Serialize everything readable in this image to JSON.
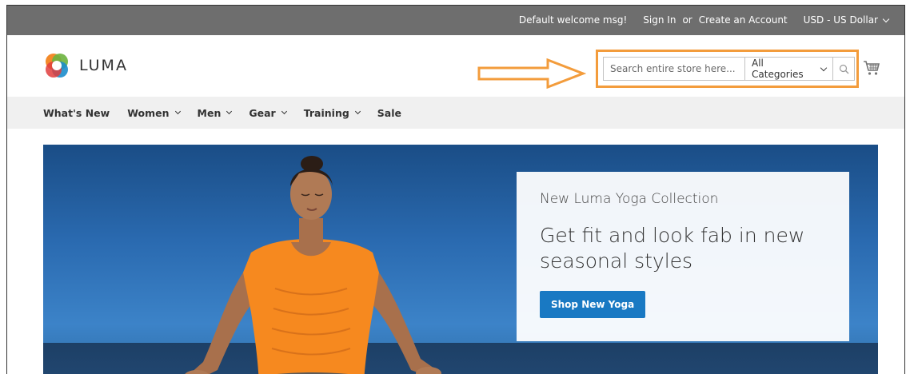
{
  "topbar": {
    "welcome": "Default welcome msg!",
    "sign_in": "Sign In",
    "or": "or",
    "create_account": "Create an Account",
    "currency": "USD - US Dollar"
  },
  "header": {
    "logo_text": "LUMA",
    "search": {
      "placeholder": "Search entire store here...",
      "category": "All Categories"
    },
    "highlight_color": "#f39c3c"
  },
  "nav": {
    "items": [
      {
        "label": "What's New",
        "dropdown": false
      },
      {
        "label": "Women",
        "dropdown": true
      },
      {
        "label": "Men",
        "dropdown": true
      },
      {
        "label": "Gear",
        "dropdown": true
      },
      {
        "label": "Training",
        "dropdown": true
      },
      {
        "label": "Sale",
        "dropdown": false
      }
    ]
  },
  "hero": {
    "subtitle": "New Luma Yoga Collection",
    "title": "Get fit and look fab in new seasonal styles",
    "cta": "Shop New Yoga"
  },
  "colors": {
    "topbar": "#6e6e6e",
    "nav_bg": "#f0f0f0",
    "primary_button": "#1979c3",
    "accent_orange": "#f39c3c"
  }
}
